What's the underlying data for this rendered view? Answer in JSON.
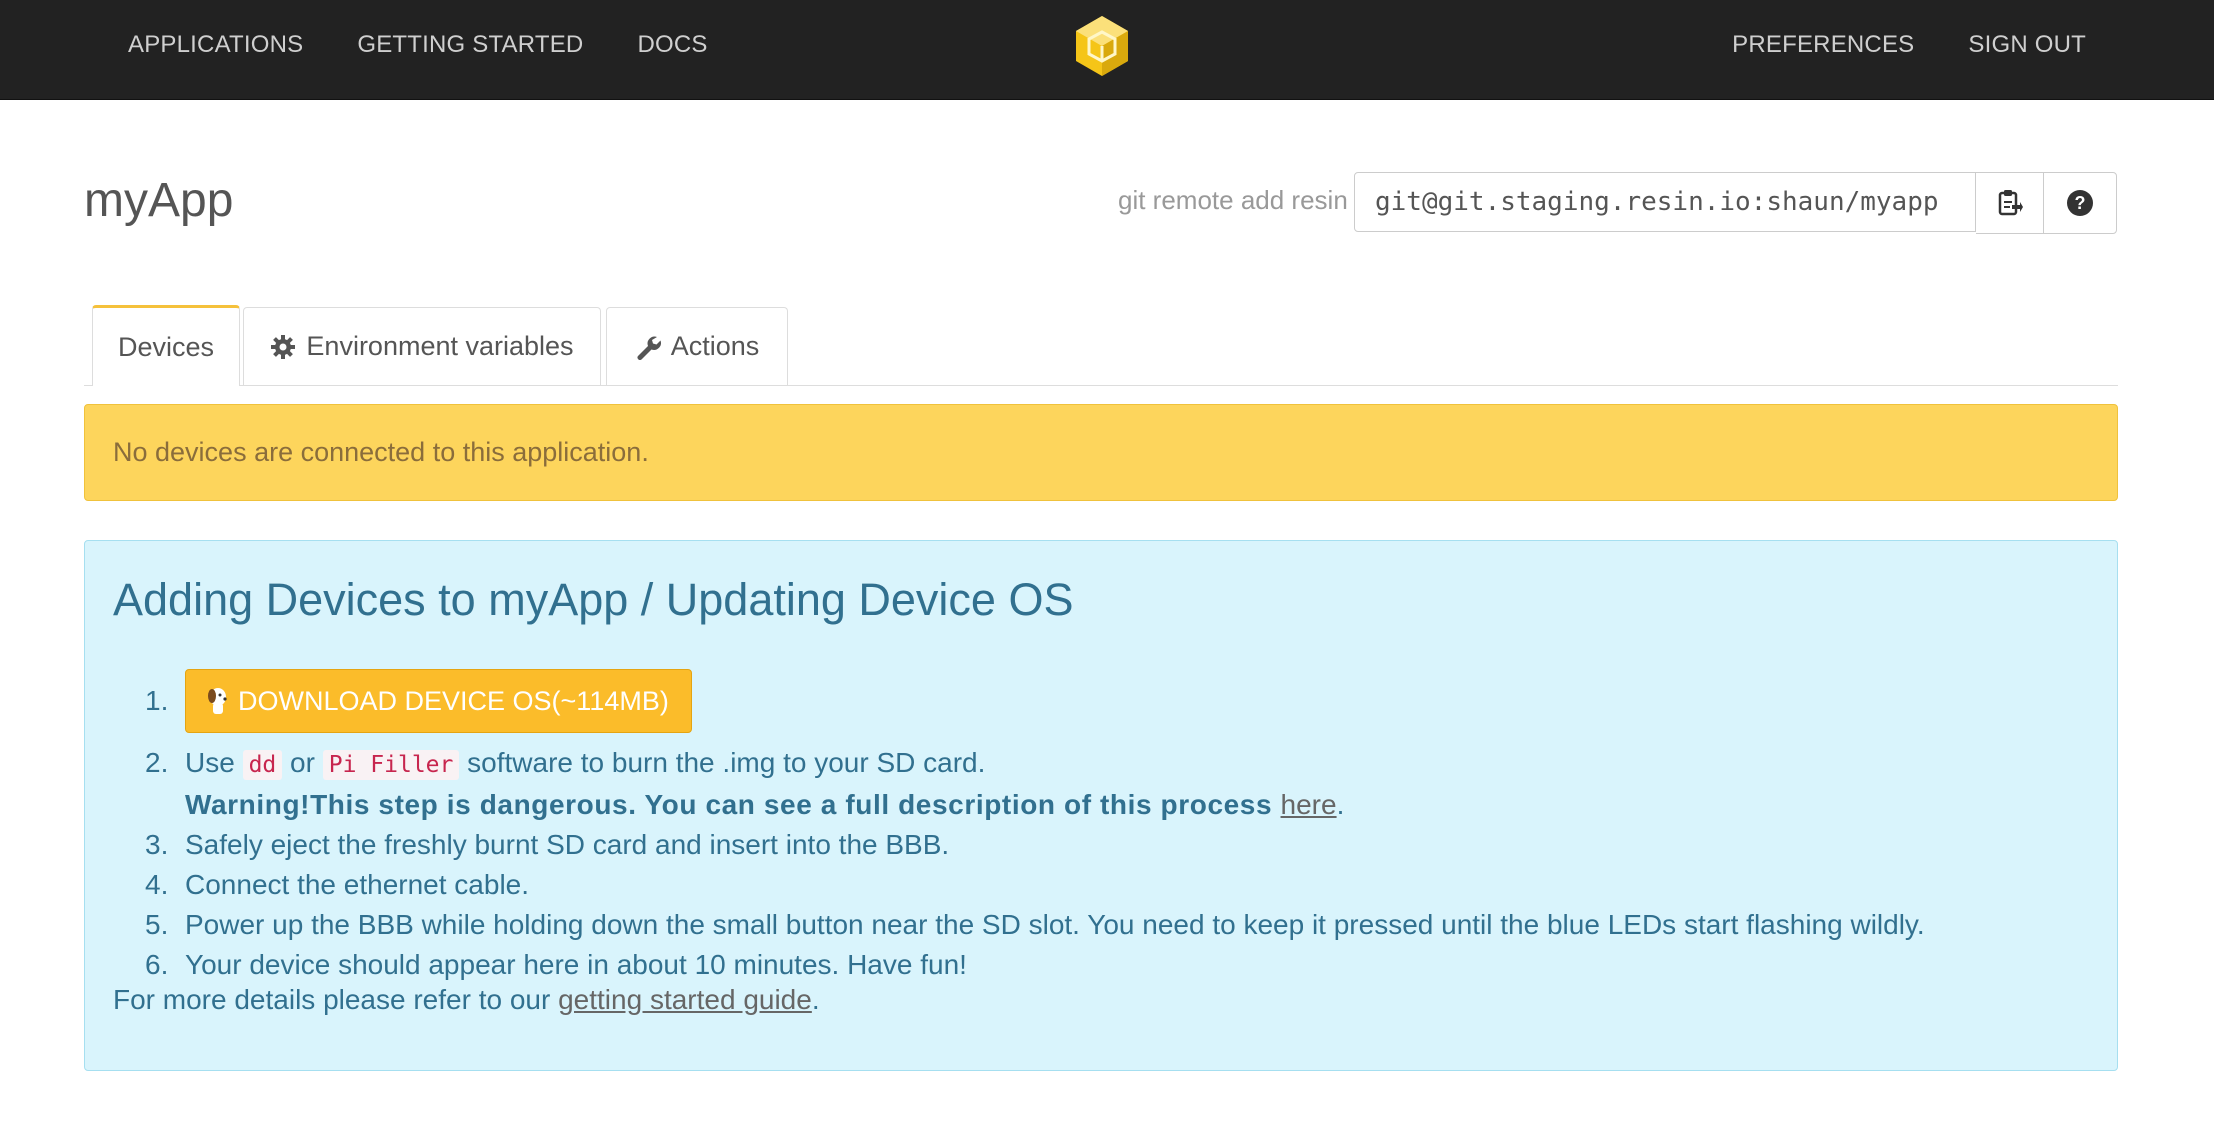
{
  "nav": {
    "left": [
      "APPLICATIONS",
      "GETTING STARTED",
      "DOCS"
    ],
    "right": [
      "PREFERENCES",
      "SIGN OUT"
    ],
    "logo_icon": "cube-logo-icon",
    "brand_color": "#f5c518"
  },
  "app": {
    "title": "myApp"
  },
  "git": {
    "label": "git remote add resin",
    "remote": "git@git.staging.resin.io:shaun/myapp",
    "copy_icon": "clipboard-icon",
    "help_icon": "question-circle-icon"
  },
  "tabs": [
    {
      "label": "Devices",
      "icon": ""
    },
    {
      "label": "Environment variables",
      "icon": "gear-icon"
    },
    {
      "label": "Actions",
      "icon": "wrench-icon"
    }
  ],
  "alert": {
    "text": "No devices are connected to this application."
  },
  "panel": {
    "title": "Adding Devices to myApp / Updating Device OS",
    "download_label": "Download Device OS(~114MB)",
    "download_icon": "beaglebone-dog-icon",
    "step2": {
      "prefix": "Use ",
      "code1": "dd",
      "mid": " or ",
      "code2": "Pi Filler",
      "suffix": " software to burn the .img to your SD card.",
      "warning": "Warning!This step is dangerous. You can see a full description of this process ",
      "warning_link": "here",
      "warning_end": "."
    },
    "step3": "Safely eject the freshly burnt SD card and insert into the BBB.",
    "step4": "Connect the ethernet cable.",
    "step5": "Power up the BBB while holding down the small button near the SD slot. You need to keep it pressed until the blue LEDs start flashing wildly.",
    "step6": "Your device should appear here in about 10 minutes. Have fun!",
    "footer_prefix": "For more details please refer to our ",
    "footer_link": "getting started guide",
    "footer_end": "."
  },
  "colors": {
    "topbar": "#222222",
    "warning_bg": "#fdd55c",
    "info_bg": "#d9f4fc",
    "info_text": "#31708f",
    "download_btn": "#fbbc2a"
  }
}
